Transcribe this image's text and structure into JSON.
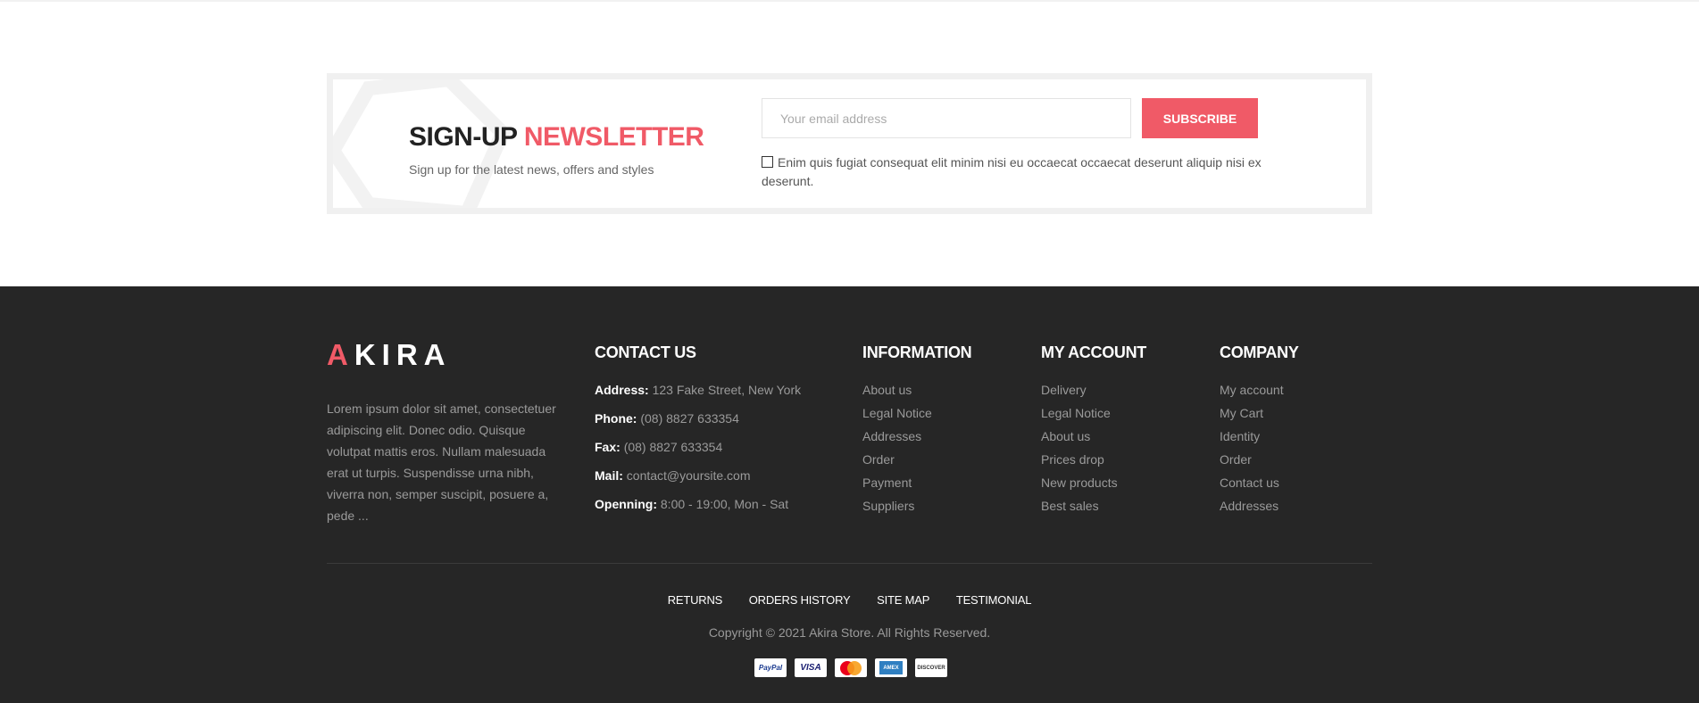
{
  "newsletter": {
    "title_main": "SIGN-UP",
    "title_accent": "NEWSLETTER",
    "subtitle": "Sign up for the latest news, offers and styles",
    "email_placeholder": "Your email address",
    "subscribe_label": "SUBSCRIBE",
    "consent_text": "Enim quis fugiat consequat elit minim nisi eu occaecat occaecat deserunt aliquip nisi ex deserunt."
  },
  "footer": {
    "logo_first": "A",
    "logo_rest": "KIRA",
    "about": "Lorem ipsum dolor sit amet, consectetuer adipiscing elit. Donec odio. Quisque volutpat mattis eros. Nullam malesuada erat ut turpis. Suspendisse urna nibh, viverra non, semper suscipit, posuere a, pede ...",
    "contact": {
      "title": "CONTACT US",
      "rows": [
        {
          "label": "Address:",
          "value": "123 Fake Street, New York"
        },
        {
          "label": "Phone:",
          "value": "(08) 8827 633354"
        },
        {
          "label": "Fax:",
          "value": "(08) 8827 633354"
        },
        {
          "label": "Mail:",
          "value": "contact@yoursite.com"
        },
        {
          "label": "Openning:",
          "value": "8:00 - 19:00, Mon - Sat"
        }
      ]
    },
    "information": {
      "title": "INFORMATION",
      "items": [
        "About us",
        "Legal Notice",
        "Addresses",
        "Order",
        "Payment",
        "Suppliers"
      ]
    },
    "my_account": {
      "title": "MY ACCOUNT",
      "items": [
        "Delivery",
        "Legal Notice",
        "About us",
        "Prices drop",
        "New products",
        "Best sales"
      ]
    },
    "company": {
      "title": "COMPANY",
      "items": [
        "My account",
        "My Cart",
        "Identity",
        "Order",
        "Contact us",
        "Addresses"
      ]
    },
    "bottom_links": [
      "RETURNS",
      "ORDERS HISTORY",
      "SITE MAP",
      "TESTIMONIAL"
    ],
    "copyright": "Copyright © 2021 Akira Store. All Rights Reserved.",
    "payments": [
      {
        "name": "paypal-icon",
        "text": "PayPal"
      },
      {
        "name": "visa-icon",
        "text": "VISA"
      },
      {
        "name": "mastercard-icon",
        "text": "MasterCard"
      },
      {
        "name": "amex-icon",
        "text": "AMEX"
      },
      {
        "name": "discover-icon",
        "text": "DISCOVER"
      }
    ]
  },
  "colors": {
    "accent": "#f05a67",
    "footer_bg": "#262626"
  }
}
